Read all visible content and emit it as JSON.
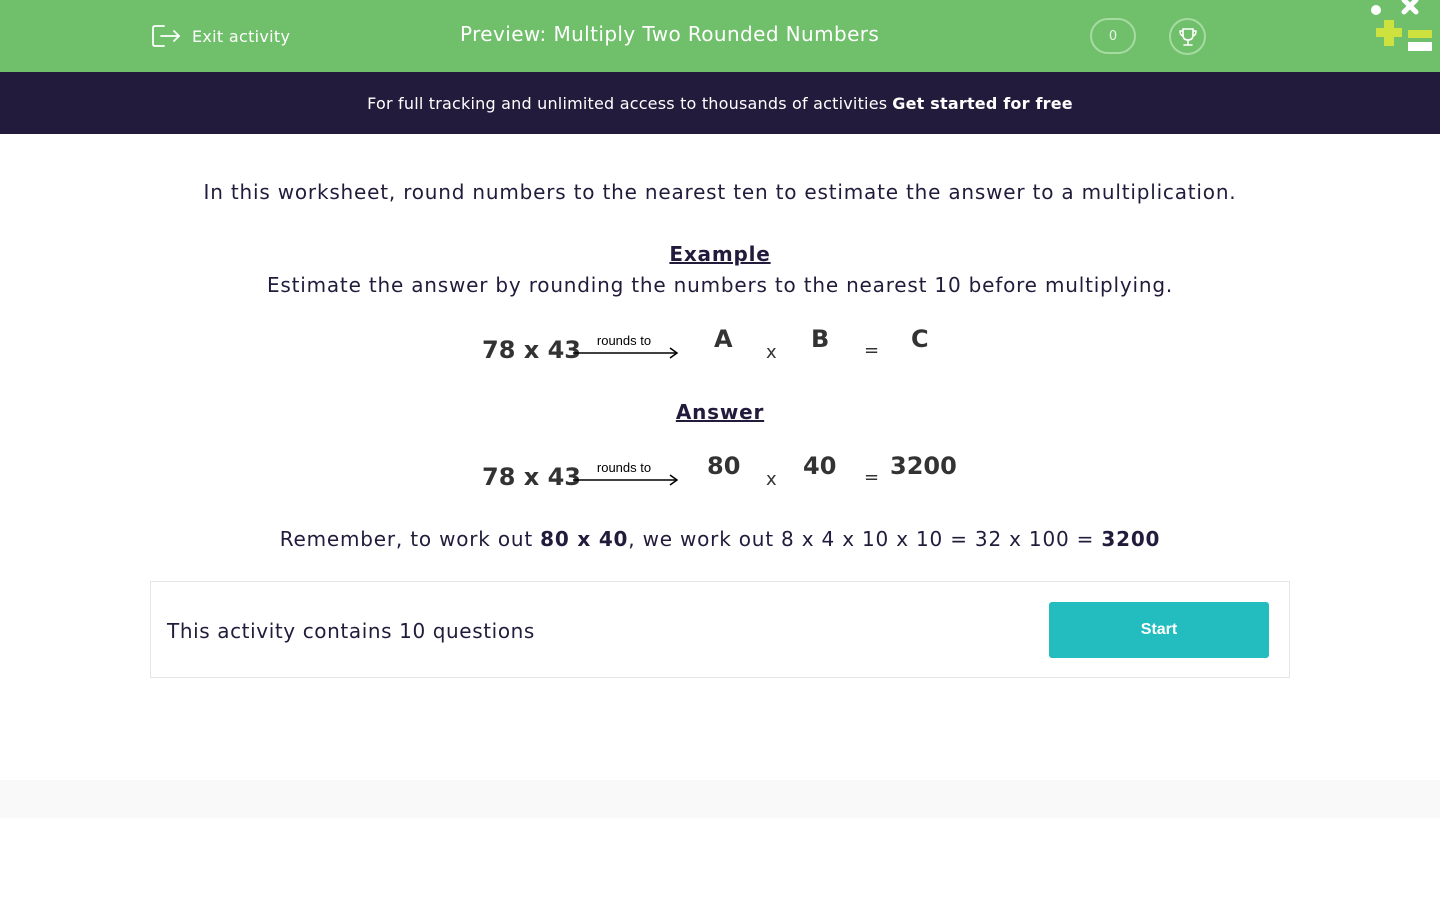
{
  "header": {
    "exit_label": "Exit activity",
    "title": "Preview: Multiply Two Rounded Numbers",
    "score": "0",
    "background_color": "#70bf6b"
  },
  "banner": {
    "text": "For full tracking and unlimited access to thousands of activities",
    "cta": "Get started for free",
    "background_color": "#231b3b"
  },
  "content": {
    "intro": "In this worksheet, round numbers to the nearest ten to estimate the answer to a multiplication.",
    "example_heading": "Example",
    "example_text": "Estimate the answer by rounding the numbers to the nearest 10 before multiplying.",
    "example_equation": {
      "expression": "78 x 43",
      "arrow_label": "rounds to",
      "a": "A",
      "times": "x",
      "b": "B",
      "equals": "=",
      "c": "C"
    },
    "answer_heading": "Answer",
    "answer_equation": {
      "expression": "78 x 43",
      "arrow_label": "rounds to",
      "a": "80",
      "times": "x",
      "b": "40",
      "equals": "=",
      "c": "3200"
    },
    "remember": {
      "prefix": "Remember, to work out",
      "bold1": "80 x 40",
      "middle": ", we work out 8 x 4 x 10 x 10 = 32 x 100 =",
      "bold2": "3200"
    }
  },
  "activity": {
    "text": "This activity contains 10 questions",
    "start_label": "Start",
    "button_color": "#23bcbf"
  }
}
